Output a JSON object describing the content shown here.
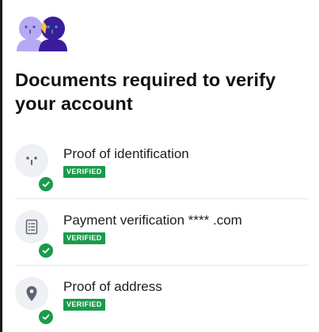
{
  "page": {
    "title": "Documents required to verify your account"
  },
  "documents": [
    {
      "name": "Proof of identification",
      "status": "VERIFIED",
      "icon": "face-icon"
    },
    {
      "name": "Payment verification **** .com",
      "status": "VERIFIED",
      "icon": "receipt-icon"
    },
    {
      "name": "Proof of address",
      "status": "VERIFIED",
      "icon": "location-pin-icon"
    }
  ],
  "colors": {
    "verified_green": "#1a9b4b",
    "avatar_light": "#b6a9f1",
    "avatar_dark": "#3b1c9c",
    "avatar_face_yellow": "#f5c242",
    "icon_bg": "#eef0f3",
    "icon_glyph": "#5d6470"
  }
}
